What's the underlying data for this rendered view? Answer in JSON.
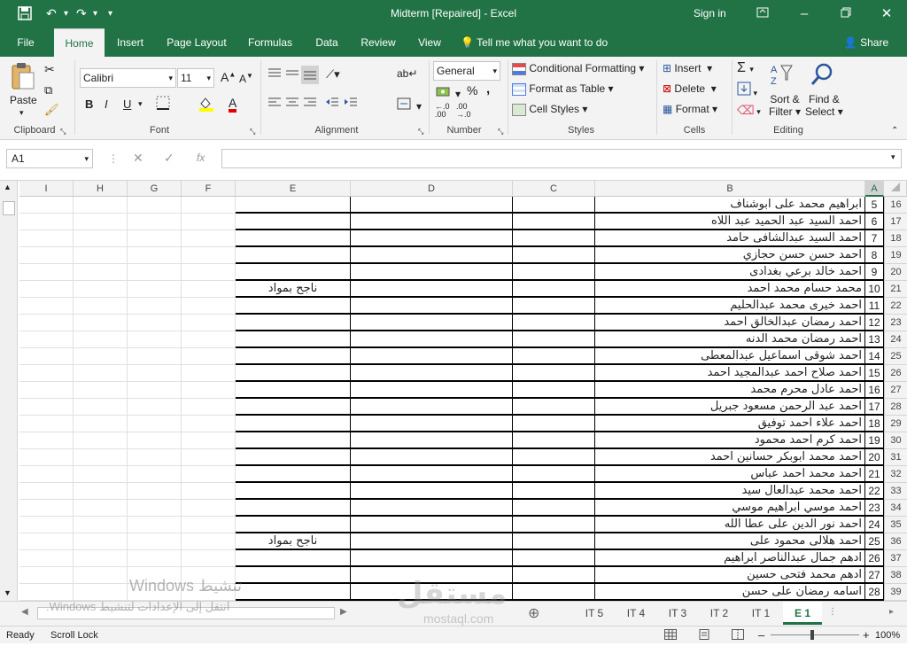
{
  "titlebar": {
    "title": "Midterm [Repaired]  -  Excel",
    "signin": "Sign in"
  },
  "tabs": [
    "File",
    "Home",
    "Insert",
    "Page Layout",
    "Formulas",
    "Data",
    "Review",
    "View"
  ],
  "tell_me": "Tell me what you want to do",
  "share": "Share",
  "ribbon": {
    "paste": "Paste",
    "font_name": "Calibri",
    "font_size": "11",
    "number_format": "General",
    "conditional_formatting": "Conditional Formatting",
    "format_as_table": "Format as Table",
    "cell_styles": "Cell Styles",
    "insert": "Insert",
    "delete": "Delete",
    "format": "Format",
    "sort_filter_1": "Sort &",
    "sort_filter_2": "Filter",
    "find_select_1": "Find &",
    "find_select_2": "Select",
    "groups": {
      "clipboard": "Clipboard",
      "font": "Font",
      "alignment": "Alignment",
      "number": "Number",
      "styles": "Styles",
      "cells": "Cells",
      "editing": "Editing"
    }
  },
  "formula": {
    "namebox": "A1",
    "fx": "fx"
  },
  "columns": [
    "I",
    "H",
    "G",
    "F",
    "E",
    "D",
    "C",
    "B",
    "A"
  ],
  "rows": [
    {
      "row": "16",
      "num": "5",
      "name": "ابراهيم محمد على ابوشناف",
      "note": ""
    },
    {
      "row": "17",
      "num": "6",
      "name": "احمد السيد عبد الحميد عبد اللاه",
      "note": ""
    },
    {
      "row": "18",
      "num": "7",
      "name": "احمد السيد عبدالشافى حامد",
      "note": ""
    },
    {
      "row": "19",
      "num": "8",
      "name": "احمد حسن حسن حجازي",
      "note": ""
    },
    {
      "row": "20",
      "num": "9",
      "name": "احمد خالد برعي بغدادى",
      "note": ""
    },
    {
      "row": "21",
      "num": "10",
      "name": "محمد حسام محمد احمد",
      "note": "ناجح بمواد"
    },
    {
      "row": "22",
      "num": "11",
      "name": "احمد خيرى محمد عبدالحليم",
      "note": ""
    },
    {
      "row": "23",
      "num": "12",
      "name": "احمد رمضان عبدالخالق احمد",
      "note": ""
    },
    {
      "row": "24",
      "num": "13",
      "name": "احمد رمضان محمد الدنه",
      "note": ""
    },
    {
      "row": "25",
      "num": "14",
      "name": "احمد شوقى اسماعيل عبدالمعطى",
      "note": ""
    },
    {
      "row": "26",
      "num": "15",
      "name": "احمد صلاح احمد عبدالمجيد احمد",
      "note": ""
    },
    {
      "row": "27",
      "num": "16",
      "name": "احمد عادل محرم محمد",
      "note": ""
    },
    {
      "row": "28",
      "num": "17",
      "name": "احمد عبد الرحمن مسعود جبريل",
      "note": ""
    },
    {
      "row": "29",
      "num": "18",
      "name": "احمد علاء احمد توفيق",
      "note": ""
    },
    {
      "row": "30",
      "num": "19",
      "name": "احمد كرم احمد محمود",
      "note": ""
    },
    {
      "row": "31",
      "num": "20",
      "name": "احمد محمد ابوبكر حسانين احمد",
      "note": ""
    },
    {
      "row": "32",
      "num": "21",
      "name": "احمد محمد احمد عباس",
      "note": ""
    },
    {
      "row": "33",
      "num": "22",
      "name": "احمد محمد عبدالعال سيد",
      "note": ""
    },
    {
      "row": "34",
      "num": "23",
      "name": "احمد موسي ابراهيم موسي",
      "note": ""
    },
    {
      "row": "35",
      "num": "24",
      "name": "احمد نور الدين على عطا الله",
      "note": ""
    },
    {
      "row": "36",
      "num": "25",
      "name": "احمد هلالى محمود على",
      "note": "ناجح بمواد"
    },
    {
      "row": "37",
      "num": "26",
      "name": "ادهم جمال عبدالناصر ابراهيم",
      "note": ""
    },
    {
      "row": "38",
      "num": "27",
      "name": "ادهم محمد فتحى حسين",
      "note": ""
    },
    {
      "row": "39",
      "num": "28",
      "name": "اسامه رمضان على حسن",
      "note": ""
    }
  ],
  "sheets": [
    "IT 5",
    "IT 4",
    "IT 3",
    "IT 2",
    "IT 1",
    "E 1"
  ],
  "active_sheet": "E 1",
  "status": {
    "ready": "Ready",
    "scroll_lock": "Scroll Lock",
    "zoom": "100%"
  },
  "watermark": {
    "line1": "تنشيط Windows",
    "line2": "انتقل إلى الإعدادات لتنشيط Windows.",
    "logo": "مستقل",
    "logo_sub": "mostaql.com"
  },
  "colors": {
    "excel_green": "#217346"
  }
}
